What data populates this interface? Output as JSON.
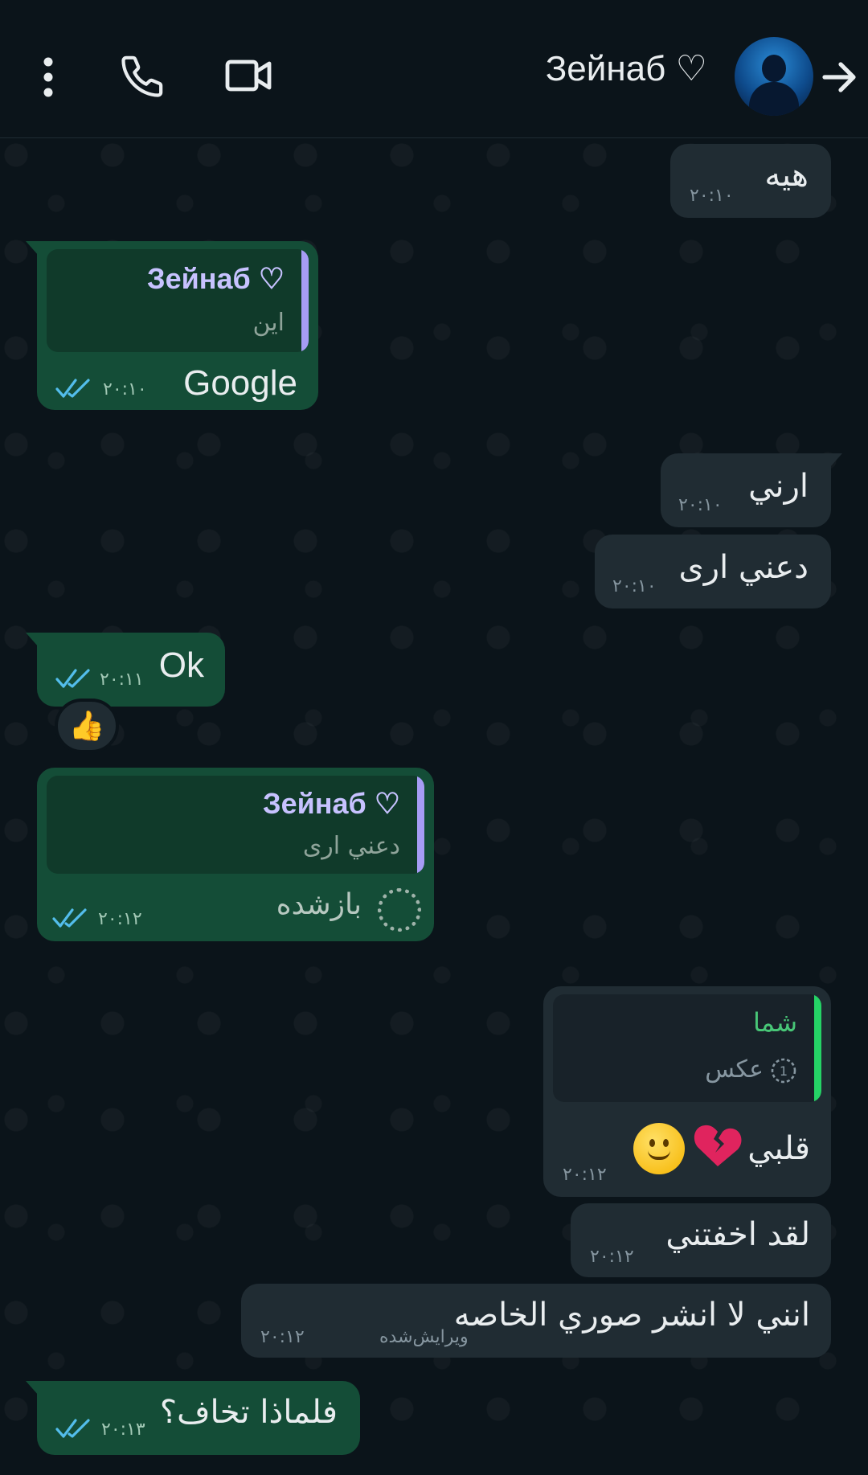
{
  "header": {
    "contact_name": "Зейнаб ♡",
    "icons": [
      "back-arrow-icon",
      "avatar",
      "video-call-icon",
      "voice-call-icon",
      "more-options-icon"
    ]
  },
  "messages": [
    {
      "id": "m1",
      "direction": "in",
      "text": "هيه",
      "time": "۲۰:۱۰"
    },
    {
      "id": "m2",
      "direction": "out",
      "quote_name": "Зейнаб ♡",
      "quote_text": "این",
      "text": "Google",
      "time": "۲۰:۱۰",
      "status": "read"
    },
    {
      "id": "m3",
      "direction": "in",
      "text": "ارني",
      "time": "۲۰:۱۰"
    },
    {
      "id": "m4",
      "direction": "in",
      "text": "دعني ارى",
      "time": "۲۰:۱۰"
    },
    {
      "id": "m5",
      "direction": "out",
      "text": "Ok",
      "time": "۲۰:۱۱",
      "status": "read",
      "reaction": "👍"
    },
    {
      "id": "m6",
      "direction": "out",
      "quote_name": "Зейнаб ♡",
      "quote_text": "دعني ارى",
      "text": "بازشده",
      "time": "۲۰:۱۲",
      "status": "read"
    },
    {
      "id": "m7",
      "direction": "in",
      "quote_name": "شما",
      "quote_text": "عکس",
      "text": "قلبي",
      "time": "۲۰:۱۲"
    },
    {
      "id": "m8",
      "direction": "in",
      "text": "لقد اخفتني",
      "time": "۲۰:۱۲"
    },
    {
      "id": "m9",
      "direction": "in",
      "text": "انني لا انشر صوري الخاصه",
      "edited_label": "ویرایش‌شده",
      "time": "۲۰:۱۲"
    },
    {
      "id": "m10",
      "direction": "out",
      "text": "فلماذا تخاف؟",
      "time": "۲۰:۱۳",
      "status": "read"
    }
  ],
  "colors": {
    "background": "#0b141a",
    "incoming_bubble": "#202c33",
    "outgoing_bubble": "#144d37",
    "read_ticks": "#53bdeb",
    "quote_accent": "#a69cf5",
    "quote_accent_self": "#25d366"
  }
}
